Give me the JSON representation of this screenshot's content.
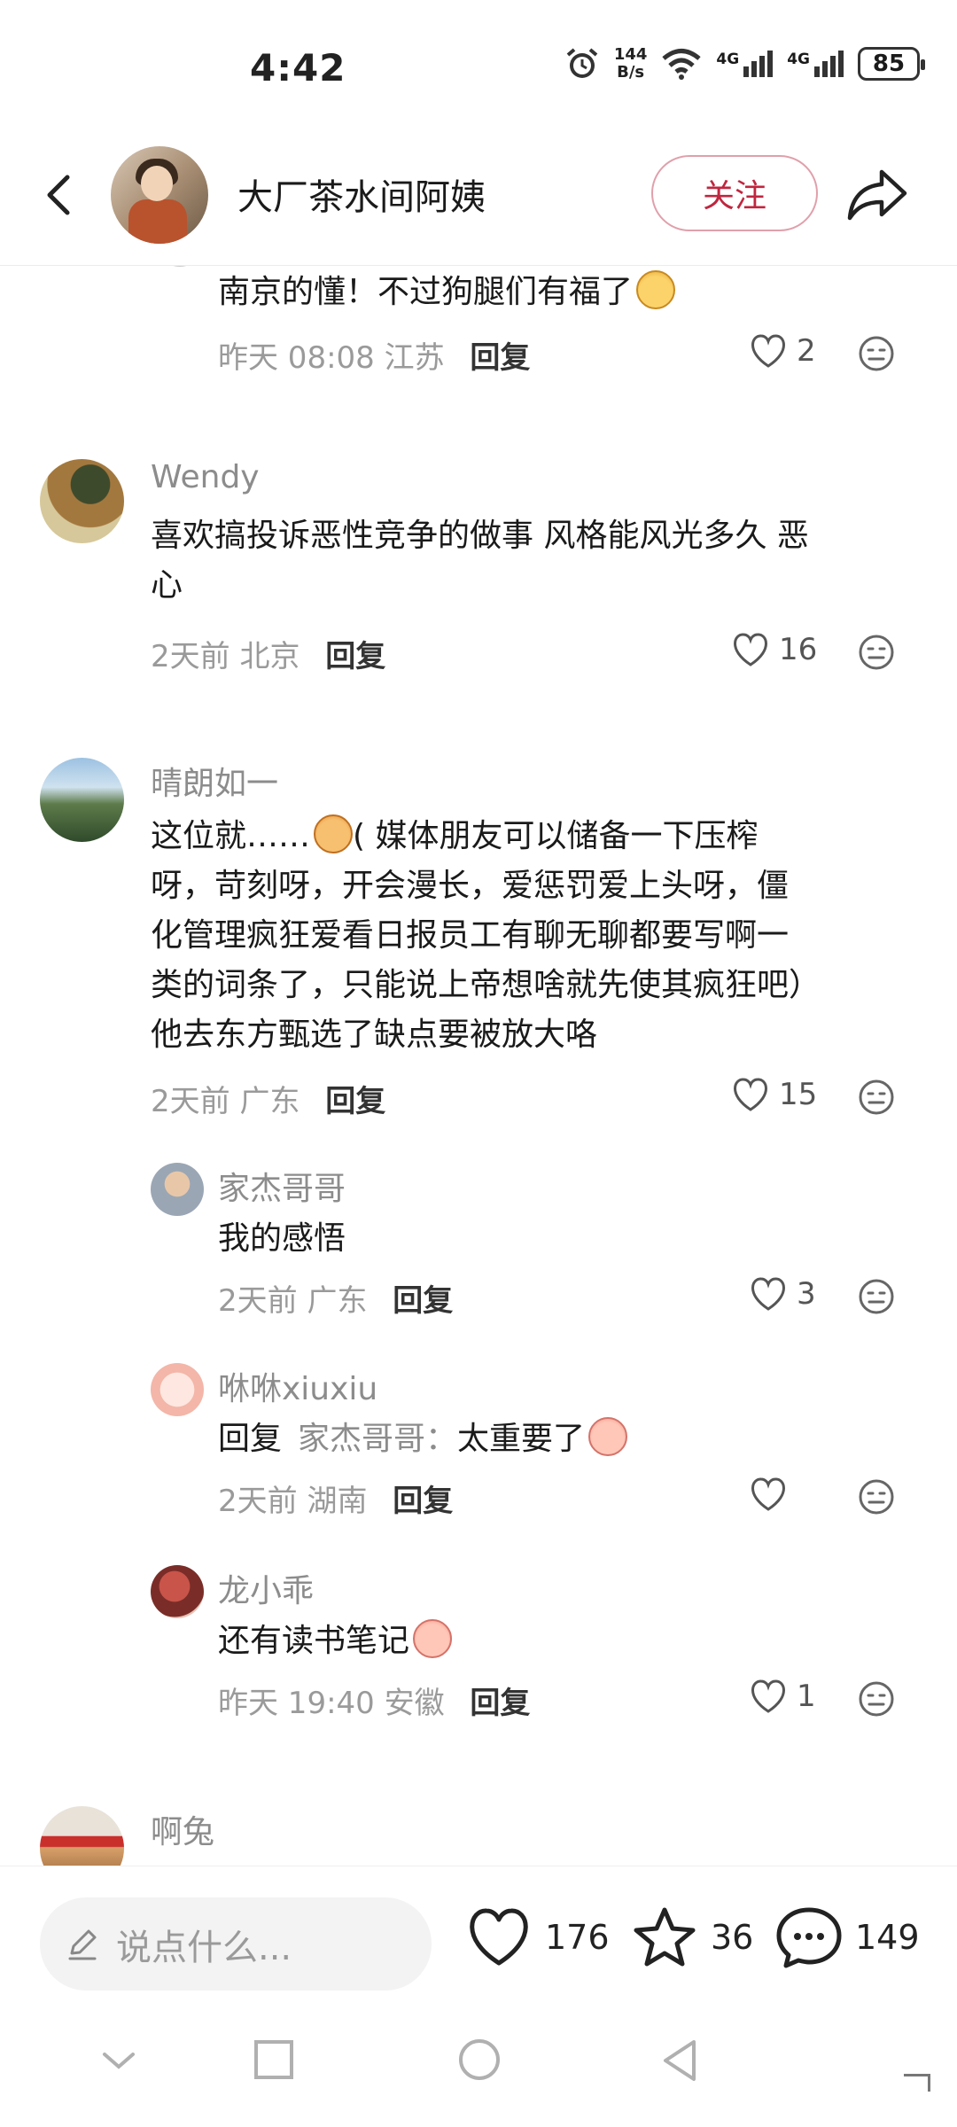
{
  "status_bar": {
    "time": "4:42",
    "net_speed_top": "144",
    "net_speed_bottom": "B/s",
    "signal1": "4G",
    "signal2": "4G",
    "battery": "85"
  },
  "header": {
    "title": "大厂茶水间阿姨",
    "follow_label": "关注"
  },
  "comments": [
    {
      "name": "",
      "text": "南京的懂！不过狗腿们有福了",
      "time": "昨天 08:08",
      "location": "江苏",
      "reply": "回复",
      "likes": "2"
    },
    {
      "name": "Wendy",
      "text_line1": "喜欢搞投诉恶性竞争的做事 风格能风光多久 恶",
      "text_line2": "心",
      "time": "2天前",
      "location": "北京",
      "reply": "回复",
      "likes": "16"
    },
    {
      "name": "晴朗如一",
      "text_line1_a": "这位就……",
      "text_line1_b": "( 媒体朋友可以储备一下压榨",
      "text_line2": "呀，苛刻呀，开会漫长，爱惩罚爱上头呀，僵",
      "text_line3": "化管理疯狂爱看日报员工有聊无聊都要写啊一",
      "text_line4": "类的词条了，只能说上帝想啥就先使其疯狂吧）",
      "text_line5": "他去东方甄选了缺点要被放大咯",
      "time": "2天前",
      "location": "广东",
      "reply": "回复",
      "likes": "15"
    }
  ],
  "replies": [
    {
      "name": "家杰哥哥",
      "text": "我的感悟",
      "time": "2天前",
      "location": "广东",
      "reply": "回复",
      "likes": "3"
    },
    {
      "name": "咻咻xiuxiu",
      "prefix": "回复",
      "target": "家杰哥哥：",
      "text": "太重要了",
      "time": "2天前",
      "location": "湖南",
      "reply": "回复",
      "likes": ""
    },
    {
      "name": "龙小乖",
      "text": "还有读书笔记",
      "time": "昨天 19:40",
      "location": "安徽",
      "reply": "回复",
      "likes": "1"
    }
  ],
  "next_comment": {
    "name": "啊兔"
  },
  "bottom_bar": {
    "placeholder": "说点什么...",
    "likes": "176",
    "favorites": "36",
    "comments": "149"
  },
  "icons": [
    "back-icon",
    "share-icon",
    "heart-icon",
    "more-icon",
    "star-icon",
    "chat-icon",
    "pencil-icon",
    "signal-icon",
    "wifi-icon",
    "alarm-icon"
  ],
  "colors": {
    "accent": "#c0263f",
    "follow_border": "#e0a0ab"
  }
}
